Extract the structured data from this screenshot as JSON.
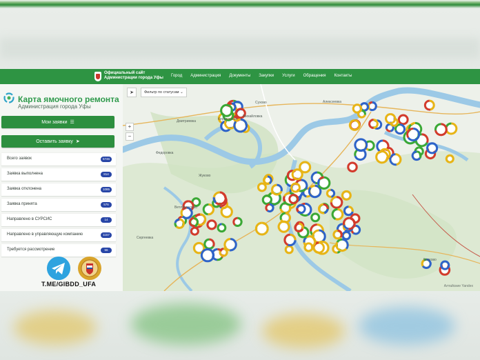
{
  "header": {
    "site_title": "Официальный сайт Администрации города Уфы",
    "nav": [
      "Город",
      "Администрация",
      "Документы",
      "Закупки",
      "Услуги",
      "Обращения",
      "Контакты"
    ]
  },
  "sidebar": {
    "app_title": "Карта ямочного ремонта",
    "app_subtitle": "Администрация города Уфы",
    "my_requests_label": "Мои заявки",
    "send_request_label": "Оставить заявку",
    "stats": [
      {
        "label": "Всего заявок",
        "count": "5746"
      },
      {
        "label": "Заявка выполнена",
        "count": "814"
      },
      {
        "label": "Заявка отклонена",
        "count": "1085"
      },
      {
        "label": "Заявка принята",
        "count": "576"
      },
      {
        "label": "Направлено в СУРСИС",
        "count": "14"
      },
      {
        "label": "Направлено в управляющую компанию",
        "count": "1157"
      },
      {
        "label": "Требуется рассмотрение",
        "count": "56"
      }
    ],
    "telegram_link": "T.ME/GIBDD_UFA"
  },
  "map": {
    "filter_label": "Фильтр по статусам",
    "places": [
      "Дмитриевка",
      "Кирилловка",
      "Михайловка",
      "Сухово",
      "Алексеевка",
      "Федоровка",
      "Жуково",
      "Ветлорослово",
      "Сергеевка",
      "Благово"
    ],
    "copyright": "Алтайские Yandex",
    "colors": {
      "yellow": "#e8b415",
      "green": "#3aa835",
      "blue": "#2e63c9",
      "red": "#d33a2c"
    }
  }
}
